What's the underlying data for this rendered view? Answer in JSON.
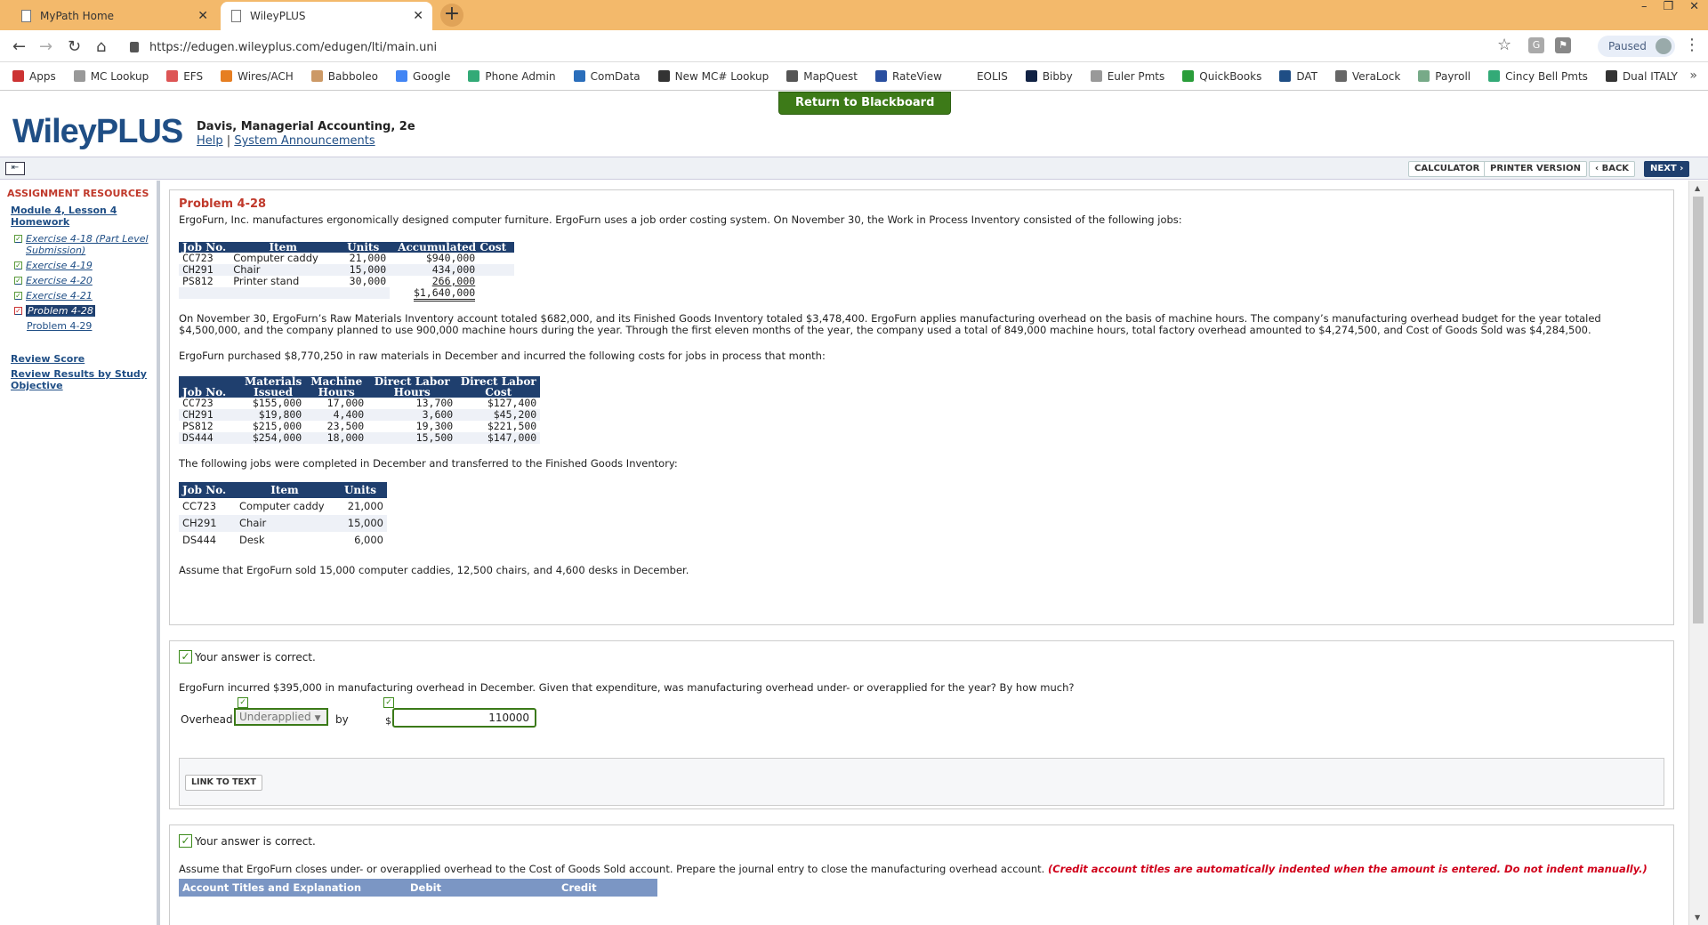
{
  "browser": {
    "tabs": [
      {
        "title": "MyPath Home"
      },
      {
        "title": "WileyPLUS"
      }
    ],
    "url": "https://edugen.wileyplus.com/edugen/lti/main.uni",
    "paused": "Paused"
  },
  "bookmarks": [
    "Apps",
    "MC Lookup",
    "EFS",
    "Wires/ACH",
    "Babboleo",
    "Google",
    "Phone Admin",
    "ComData",
    "New MC# Lookup",
    "MapQuest",
    "RateView",
    "EOLIS",
    "Bibby",
    "Euler Pmts",
    "QuickBooks",
    "DAT",
    "VeraLock",
    "Payroll",
    "Cincy Bell Pmts",
    "Dual ITALY"
  ],
  "header": {
    "logo": "WileyPLUS",
    "course": "Davis, Managerial Accounting, 2e",
    "help": "Help",
    "sep": "|",
    "announcements": "System Announcements",
    "return": "Return to Blackboard"
  },
  "actions": {
    "calculator": "CALCULATOR",
    "printer": "PRINTER VERSION",
    "back": "‹ BACK",
    "next": "NEXT ›"
  },
  "sidebar": {
    "title": "ASSIGNMENT RESOURCES",
    "module": "Module 4, Lesson 4 Homework",
    "items": [
      "Exercise 4-18 (Part Level Submission)",
      "Exercise 4-19",
      "Exercise 4-20",
      "Exercise 4-21",
      "Problem 4-28"
    ],
    "next_item": "Problem 4-29",
    "review_score": "Review Score",
    "review_results": "Review Results by Study Objective"
  },
  "problem": {
    "title": "Problem 4-28",
    "intro": "ErgoFurn, Inc. manufactures ergonomically designed computer furniture. ErgoFurn uses a job order costing system. On November 30, the Work in Process Inventory consisted of the following jobs:",
    "t1_headers": [
      "Job No.",
      "Item",
      "Units",
      "Accumulated Cost"
    ],
    "t1_rows": [
      [
        "CC723",
        "Computer caddy",
        "21,000",
        "$940,000"
      ],
      [
        "CH291",
        "Chair",
        "15,000",
        "434,000"
      ],
      [
        "PS812",
        "Printer stand",
        "30,000",
        "266,000"
      ]
    ],
    "t1_total": "$1,640,000",
    "para2": "On November 30, ErgoFurn’s Raw Materials Inventory account totaled $682,000, and its Finished Goods Inventory totaled $3,478,400. ErgoFurn applies manufacturing overhead on the basis of machine hours. The company’s manufacturing overhead budget for the year totaled $4,500,000, and the company planned to use 900,000 machine hours during the year. Through the first eleven months of the year, the company used a total of 849,000 machine hours, total factory overhead amounted to $4,274,500, and Cost of Goods Sold was $4,284,500.",
    "para3": "ErgoFurn purchased $8,770,250 in raw materials in December and incurred the following costs for jobs in process that month:",
    "t2_headers": [
      "Job No.",
      "Materials Issued",
      "Machine Hours",
      "Direct Labor Hours",
      "Direct Labor Cost"
    ],
    "t2_rows": [
      [
        "CC723",
        "$155,000",
        "17,000",
        "13,700",
        "$127,400"
      ],
      [
        "CH291",
        "$19,800",
        "4,400",
        "3,600",
        "$45,200"
      ],
      [
        "PS812",
        "$215,000",
        "23,500",
        "19,300",
        "$221,500"
      ],
      [
        "DS444",
        "$254,000",
        "18,000",
        "15,500",
        "$147,000"
      ]
    ],
    "para4": "The following jobs were completed in December and transferred to the Finished Goods Inventory:",
    "t3_headers": [
      "Job No.",
      "Item",
      "Units"
    ],
    "t3_rows": [
      [
        "CC723",
        "Computer caddy",
        "21,000"
      ],
      [
        "CH291",
        "Chair",
        "15,000"
      ],
      [
        "DS444",
        "Desk",
        "6,000"
      ]
    ],
    "para5": "Assume that ErgoFurn sold 15,000 computer caddies, 12,500 chairs, and 4,600 desks in December."
  },
  "q1": {
    "correct": "Your answer is correct.",
    "question": "ErgoFurn incurred $395,000 in manufacturing overhead in December. Given that expenditure, was manufacturing overhead under- or overapplied for the year? By how much?",
    "overhead_label": "Overhead",
    "select_value": "Underapplied",
    "by": "by",
    "dollar": "$",
    "amount": "110000",
    "link_to_text": "LINK TO TEXT"
  },
  "q2": {
    "correct": "Your answer is correct.",
    "question": "Assume that ErgoFurn closes under- or overapplied overhead to the Cost of Goods Sold account. Prepare the journal entry to close the manufacturing overhead account.",
    "note": "(Credit account titles are automatically indented when the amount is entered. Do not indent manually.)",
    "headers": [
      "Account Titles and Explanation",
      "Debit",
      "Credit"
    ]
  }
}
